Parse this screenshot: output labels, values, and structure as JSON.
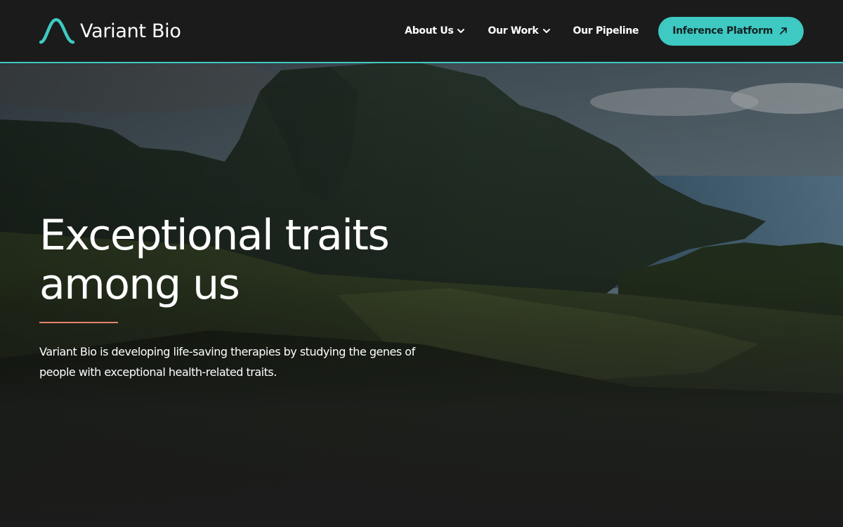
{
  "brand": {
    "name": "Variant Bio",
    "accent_color": "#3ec9c2",
    "highlight_color": "#e8826b"
  },
  "nav": {
    "items": [
      {
        "label": "About Us",
        "has_dropdown": true
      },
      {
        "label": "Our Work",
        "has_dropdown": true
      },
      {
        "label": "Our Pipeline",
        "has_dropdown": false
      }
    ],
    "cta_label": "Inference Platform",
    "cta_icon": "external-arrow-icon"
  },
  "hero": {
    "headline": "Exceptional traits among us",
    "description": "Variant Bio is developing life-saving therapies by studying the genes of people with exceptional health-related traits."
  }
}
